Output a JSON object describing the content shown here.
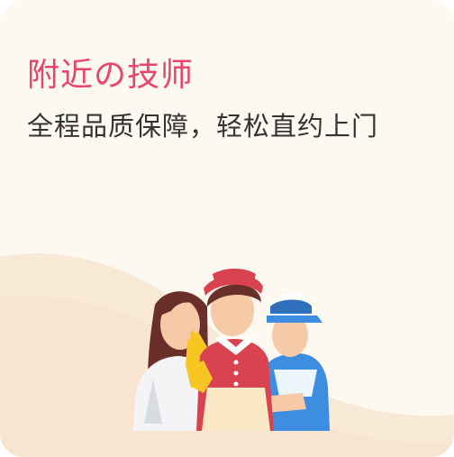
{
  "card": {
    "title": "附近の技师",
    "subtitle": "全程品质保障，轻松直约上门",
    "illustration": "service-workers-illustration"
  },
  "colors": {
    "background": "#fdf8f0",
    "title": "#e8456b",
    "subtitle": "#333333",
    "wave": "#f8e8d6"
  }
}
